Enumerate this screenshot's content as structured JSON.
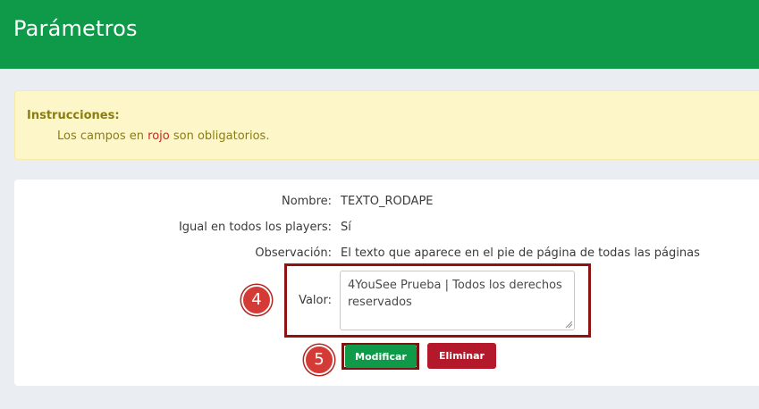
{
  "header": {
    "title": "Parámetros"
  },
  "alert": {
    "title": "Instrucciones:",
    "text_before": "Los campos en ",
    "text_red": "rojo",
    "text_after": " son obligatorios."
  },
  "form": {
    "nombre_label": "Nombre:",
    "nombre_value": "TEXTO_RODAPE",
    "igual_label": "Igual en todos los players:",
    "igual_value": "Sí",
    "observacion_label": "Observación:",
    "observacion_value": "El texto que aparece en el pie de página de todas las páginas",
    "valor_label": "Valor:",
    "valor_value": "4YouSee Prueba | Todos los derechos reservados"
  },
  "buttons": {
    "modificar": "Modificar",
    "eliminar": "Eliminar"
  },
  "callouts": {
    "step4": "4",
    "step5": "5"
  },
  "colors": {
    "header_green": "#0e9a48",
    "alert_bg": "#fdf6c9",
    "required_red": "#d61d1d",
    "danger": "#b3192b",
    "highlight": "#8e1414"
  }
}
